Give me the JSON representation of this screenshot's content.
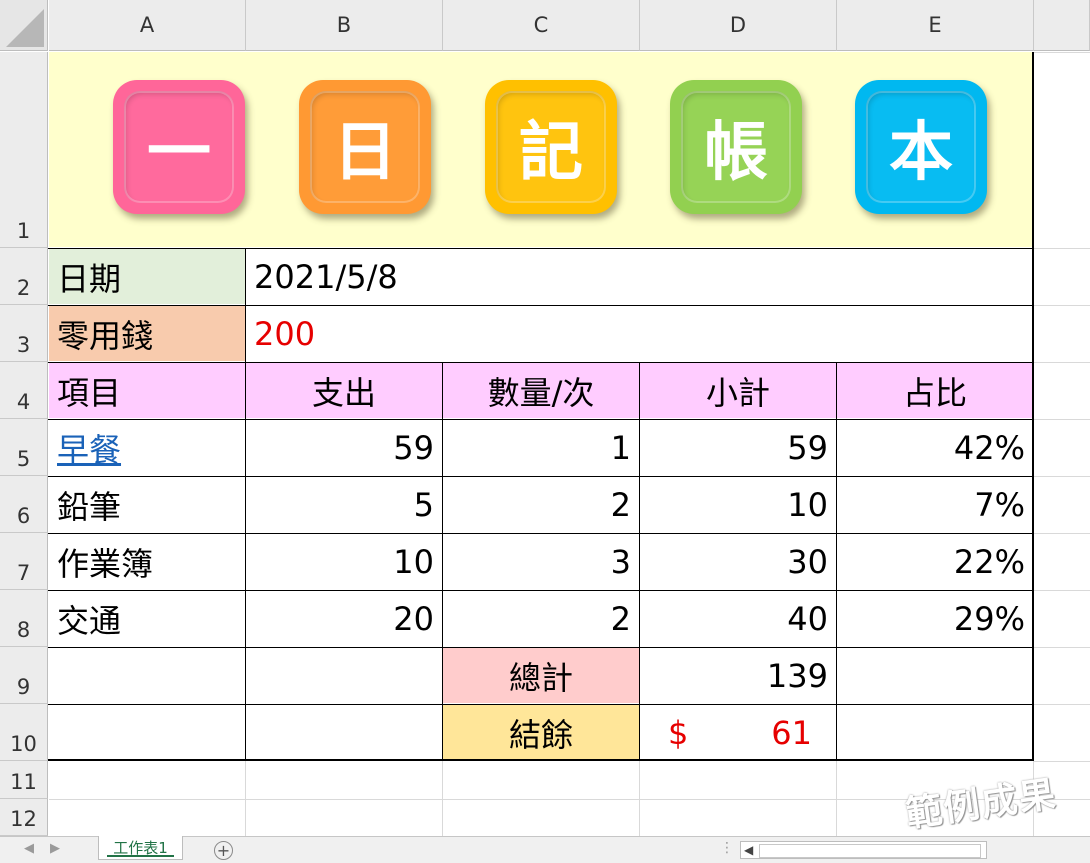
{
  "columns": [
    "A",
    "B",
    "C",
    "D",
    "E"
  ],
  "rows": [
    "1",
    "2",
    "3",
    "4",
    "5",
    "6",
    "7",
    "8",
    "9",
    "10",
    "11",
    "12"
  ],
  "banner": {
    "tiles": [
      {
        "char": "一",
        "color": "#ff6699"
      },
      {
        "char": "日",
        "color": "#ff9933"
      },
      {
        "char": "記",
        "color": "#ffc000"
      },
      {
        "char": "帳",
        "color": "#92d050"
      },
      {
        "char": "本",
        "color": "#00b8f0"
      }
    ]
  },
  "date": {
    "label": "日期",
    "value": "2021/5/8"
  },
  "allowance": {
    "label": "零用錢",
    "value": "200"
  },
  "table": {
    "headers": [
      "項目",
      "支出",
      "數量/次",
      "小計",
      "占比"
    ],
    "rows": [
      {
        "item": "早餐",
        "cost": "59",
        "qty": "1",
        "subtotal": "59",
        "pct": "42%"
      },
      {
        "item": "鉛筆",
        "cost": "5",
        "qty": "2",
        "subtotal": "10",
        "pct": "7%"
      },
      {
        "item": "作業簿",
        "cost": "10",
        "qty": "3",
        "subtotal": "30",
        "pct": "22%"
      },
      {
        "item": "交通",
        "cost": "20",
        "qty": "2",
        "subtotal": "40",
        "pct": "29%"
      }
    ]
  },
  "total": {
    "label": "總計",
    "value": "139"
  },
  "balance": {
    "label": "結餘",
    "currency": "$",
    "value": "61"
  },
  "sheet_tab": "工作表1",
  "watermark": "範例成果",
  "colors": {
    "banner_bg": "#ffffcc",
    "date_label_bg": "#e2efda",
    "allowance_label_bg": "#f8cbad",
    "header_bg": "#ffccff",
    "total_bg": "#ffcccc",
    "balance_bg": "#ffe699",
    "accent_red": "#e60000",
    "link_blue": "#1a62b8"
  }
}
